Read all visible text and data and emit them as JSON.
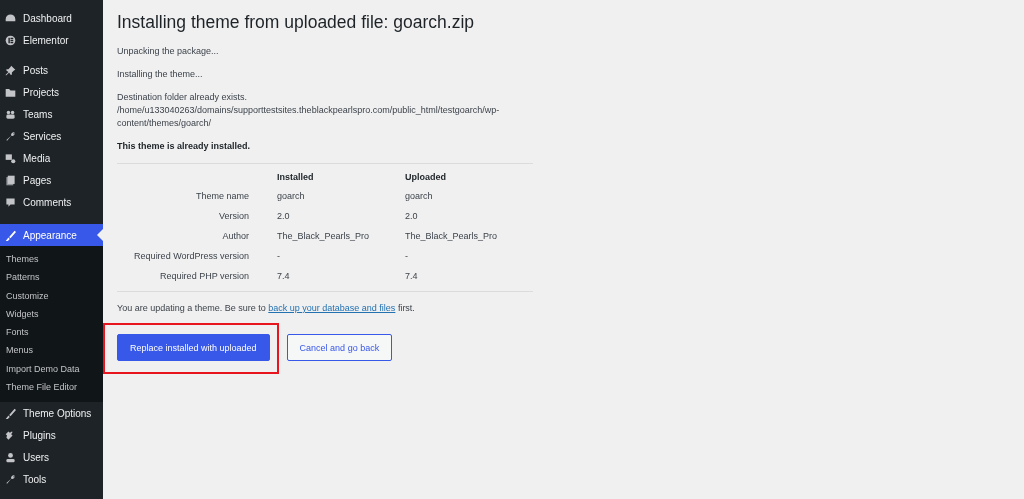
{
  "sidebar": {
    "items": [
      {
        "label": "Dashboard",
        "selected": false
      },
      {
        "label": "Elementor",
        "selected": false
      },
      {
        "label": "Posts",
        "selected": false
      },
      {
        "label": "Projects",
        "selected": false
      },
      {
        "label": "Teams",
        "selected": false
      },
      {
        "label": "Services",
        "selected": false
      },
      {
        "label": "Media",
        "selected": false
      },
      {
        "label": "Pages",
        "selected": false
      },
      {
        "label": "Comments",
        "selected": false
      },
      {
        "label": "Appearance",
        "selected": true,
        "children": [
          {
            "label": "Themes"
          },
          {
            "label": "Patterns"
          },
          {
            "label": "Customize"
          },
          {
            "label": "Widgets"
          },
          {
            "label": "Fonts"
          },
          {
            "label": "Menus"
          },
          {
            "label": "Import Demo Data"
          },
          {
            "label": "Theme File Editor"
          }
        ]
      },
      {
        "label": "Theme Options",
        "selected": false
      },
      {
        "label": "Plugins",
        "selected": false
      },
      {
        "label": "Users",
        "selected": false
      },
      {
        "label": "Tools",
        "selected": false
      }
    ]
  },
  "title": "Installing theme from uploaded file: goarch.zip",
  "messages": [
    "Unpacking the package...",
    "Installing the theme...",
    "Destination folder already exists. /home/u133040263/domains/supporttestsites.theblackpearlspro.com/public_html/testgoarch/wp-content/themes/goarch/"
  ],
  "notice": "This theme is already installed.",
  "table": {
    "columns": [
      "Installed",
      "Uploaded"
    ],
    "rows": [
      {
        "label": "Theme name",
        "installed": "goarch",
        "uploaded": "goarch"
      },
      {
        "label": "Version",
        "installed": "2.0",
        "uploaded": "2.0"
      },
      {
        "label": "Author",
        "installed": "The_Black_Pearls_Pro",
        "uploaded": "The_Black_Pearls_Pro"
      },
      {
        "label": "Required WordPress version",
        "installed": "-",
        "uploaded": "-"
      },
      {
        "label": "Required PHP version",
        "installed": "7.4",
        "uploaded": "7.4"
      }
    ]
  },
  "warning": {
    "before": "You are updating a theme. Be sure to",
    "link": "back up your database and files",
    "after": "first."
  },
  "buttons": [
    {
      "label": "Replace installed with uploaded",
      "kind": "primary",
      "highlighted": true
    },
    {
      "label": "Cancel and go back",
      "kind": "secondary",
      "highlighted": false
    }
  ]
}
